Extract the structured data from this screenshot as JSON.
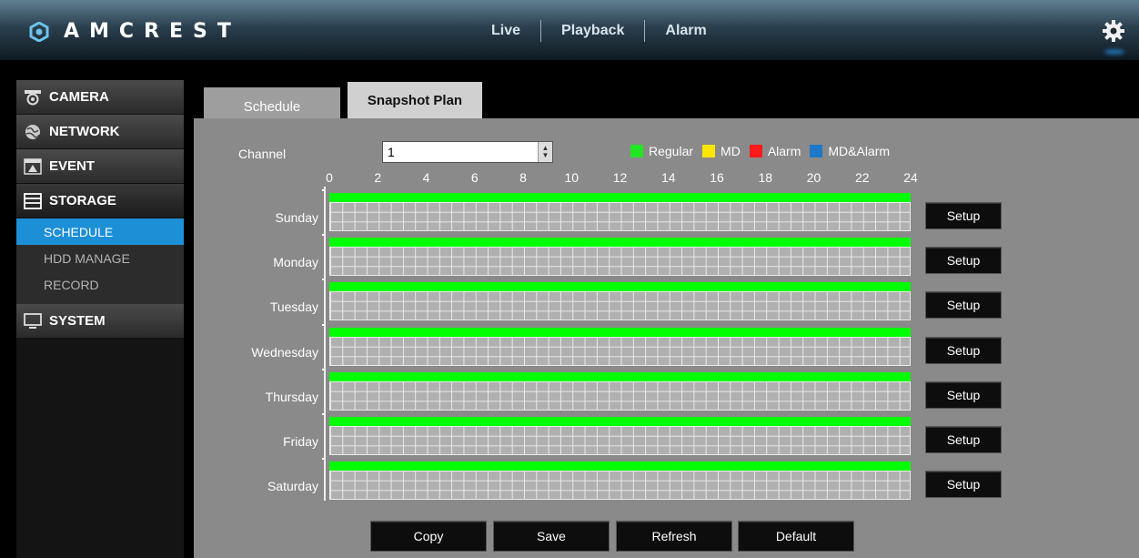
{
  "header": {
    "brand": "AMCREST",
    "nav": [
      "Live",
      "Playback",
      "Alarm"
    ]
  },
  "sidebar": {
    "sections": [
      {
        "label": "CAMERA",
        "icon": "camera-icon"
      },
      {
        "label": "NETWORK",
        "icon": "network-icon"
      },
      {
        "label": "EVENT",
        "icon": "event-icon"
      },
      {
        "label": "STORAGE",
        "icon": "storage-icon",
        "expanded": true,
        "items": [
          "SCHEDULE",
          "HDD MANAGE",
          "RECORD"
        ],
        "selected": "SCHEDULE"
      },
      {
        "label": "SYSTEM",
        "icon": "monitor-icon"
      }
    ]
  },
  "tabs": {
    "schedule": "Schedule",
    "snapshot": "Snapshot Plan",
    "active": "Snapshot Plan"
  },
  "form": {
    "channel_label": "Channel",
    "channel_value": "1"
  },
  "legend": [
    {
      "label": "Regular",
      "color": "#22e622"
    },
    {
      "label": "MD",
      "color": "#ffe600"
    },
    {
      "label": "Alarm",
      "color": "#ff1a1a"
    },
    {
      "label": "MD&Alarm",
      "color": "#1e78c8"
    }
  ],
  "timeline": {
    "hour_labels": [
      "0",
      "2",
      "4",
      "6",
      "8",
      "10",
      "12",
      "14",
      "16",
      "18",
      "20",
      "22",
      "24"
    ],
    "days": [
      "Sunday",
      "Monday",
      "Tuesday",
      "Wednesday",
      "Thursday",
      "Friday",
      "Saturday"
    ],
    "regular_color": "#00ff00",
    "regular_span": [
      0,
      24
    ]
  },
  "buttons": {
    "setup": "Setup",
    "copy": "Copy",
    "save": "Save",
    "refresh": "Refresh",
    "default": "Default"
  }
}
